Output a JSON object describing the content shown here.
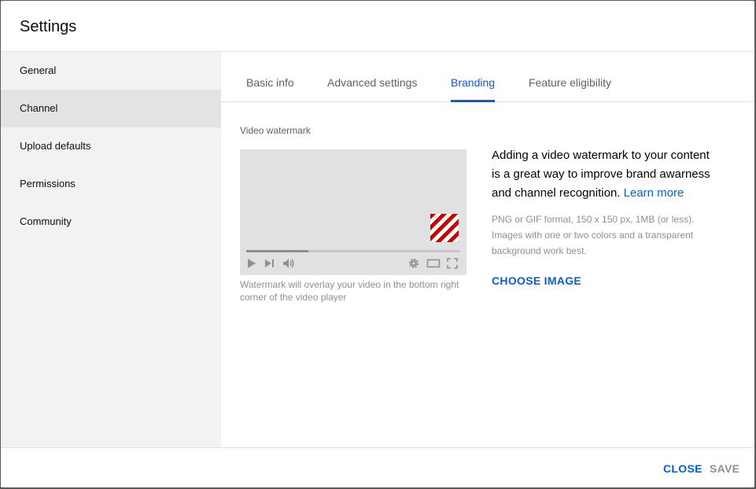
{
  "dialog": {
    "title": "Settings"
  },
  "sidebar": {
    "items": [
      {
        "label": "General"
      },
      {
        "label": "Channel"
      },
      {
        "label": "Upload defaults"
      },
      {
        "label": "Permissions"
      },
      {
        "label": "Community"
      }
    ],
    "active": "Channel"
  },
  "tabs": {
    "items": [
      {
        "label": "Basic info"
      },
      {
        "label": "Advanced settings"
      },
      {
        "label": "Branding"
      },
      {
        "label": "Feature eligibility"
      }
    ],
    "active": "Branding"
  },
  "branding": {
    "section_label": "Video watermark",
    "player": {
      "progress": 0.29,
      "watermark_colors": [
        "#cc0000",
        "#ffffff"
      ],
      "controls": [
        "play-icon",
        "next-icon",
        "volume-icon",
        "gear-icon",
        "theater-icon",
        "fullscreen-icon"
      ]
    },
    "caption": "Watermark will overlay your video in the bottom right corner of the video player",
    "description": "Adding a video watermark to your content is a great way to improve brand awarness and channel recognition.",
    "learn_more": "Learn more",
    "note": "PNG or GIF format, 150 x 150 px, 1MB (or less). Images with one or two colors and a transparent background work best.",
    "choose_image": "CHOOSE IMAGE"
  },
  "footer": {
    "close_label": "CLOSE",
    "save_label": "SAVE"
  },
  "colors": {
    "accent": "#065fd4",
    "sidebar_bg": "#f2f2f2",
    "sidebar_active_bg": "#e3e3e3",
    "muted_text": "#909090"
  }
}
